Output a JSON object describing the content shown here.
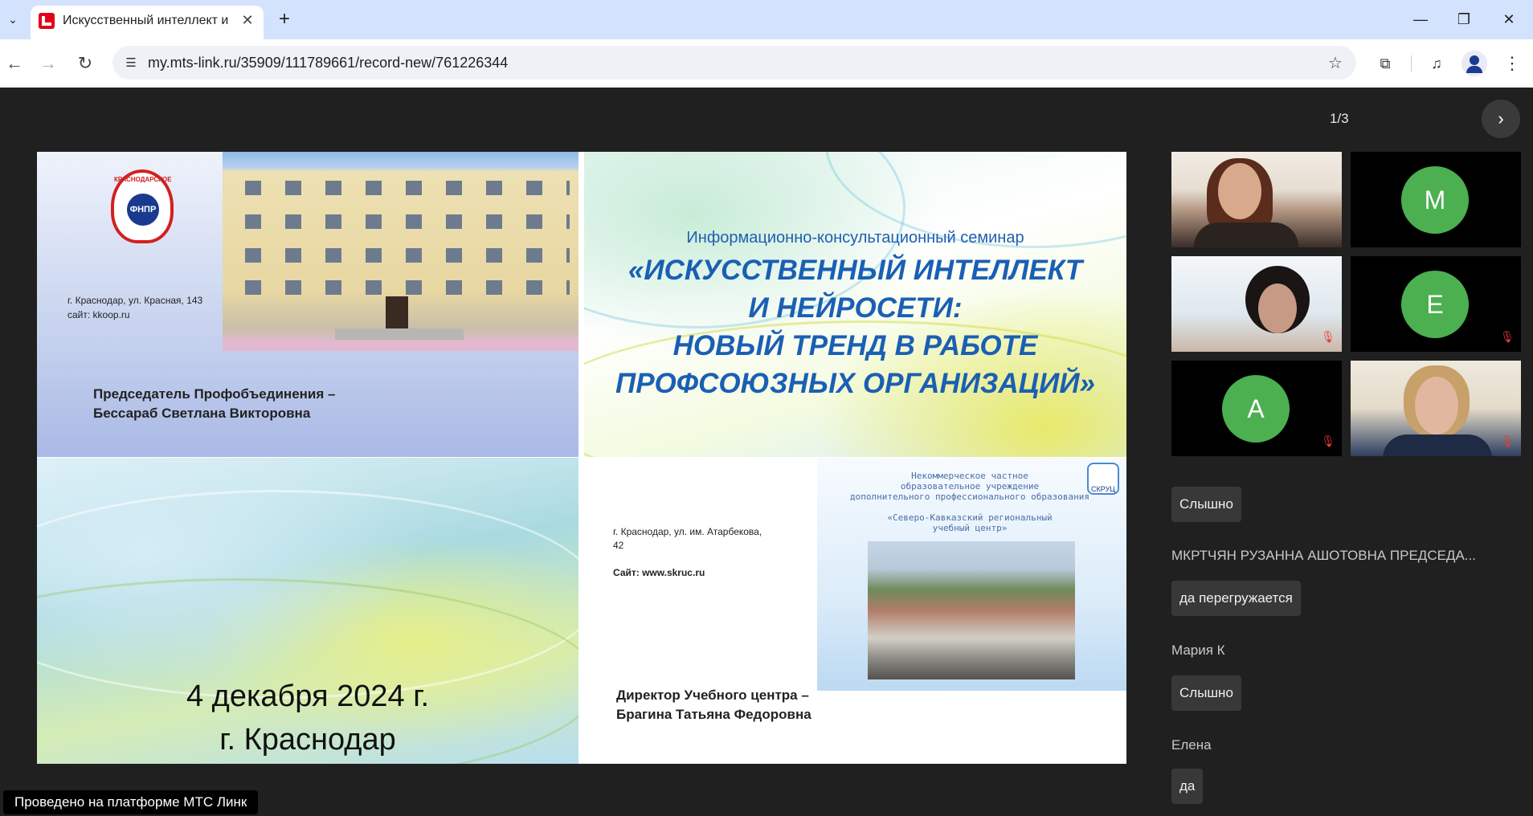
{
  "browser": {
    "tab_title": "Искусственный интеллект и не",
    "url": "my.mts-link.ru/35909/111789661/record-new/761226344"
  },
  "viewer": {
    "page_counter": "1/3"
  },
  "slide": {
    "q1": {
      "logo_text": "ФНПР",
      "logo_top": "КРАСНОДАРСКОЕ",
      "address": "г. Краснодар, ул. Красная, 143\nсайт: kkoop.ru",
      "chair": "Председатель Профобъединения –\nБессараб Светлана Викторовна"
    },
    "q2": {
      "kicker": "Информационно-консультационный  семинар",
      "title": "«ИСКУССТВЕННЫЙ ИНТЕЛЛЕКТ\nИ НЕЙРОСЕТИ:\nНОВЫЙ ТРЕНД В РАБОТЕ\nПРОФСОЮЗНЫХ ОРГАНИЗАЦИЙ»"
    },
    "q3": {
      "date": "4 декабря 2024 г.\nг.  Краснодар"
    },
    "q4": {
      "address": "г. Краснодар, ул. им. Атарбекова,\n42",
      "site": "Сайт: www.skruc.ru",
      "org": "Некоммерческое частное\nобразовательное учреждение\nдополнительного профессионального образования\n\n«Северо-Кавказский региональный\nучебный центр»",
      "logo": "СКРУЦ",
      "director": "Директор Учебного центра –\nБрагина Татьяна Федоровна"
    }
  },
  "participants": [
    {
      "initial": "M",
      "muted": false
    },
    {
      "initial": "E",
      "muted": true
    },
    {
      "initial": "A",
      "muted": true
    }
  ],
  "chat": [
    {
      "author": "",
      "text": "Слышно"
    },
    {
      "author": "МКРТЧЯН РУЗАННА АШОТОВНА ПРЕДСЕДА...",
      "text": "да перегружается"
    },
    {
      "author": "Мария К",
      "text": "Слышно"
    },
    {
      "author": "Елена",
      "text": "да"
    }
  ],
  "footer": {
    "badge": "Проведено на платформе МТС Линк"
  },
  "colors": {
    "avatar_green": "#4caf50",
    "mute_red": "#e53935",
    "slide_title_blue": "#1a5fb4"
  }
}
